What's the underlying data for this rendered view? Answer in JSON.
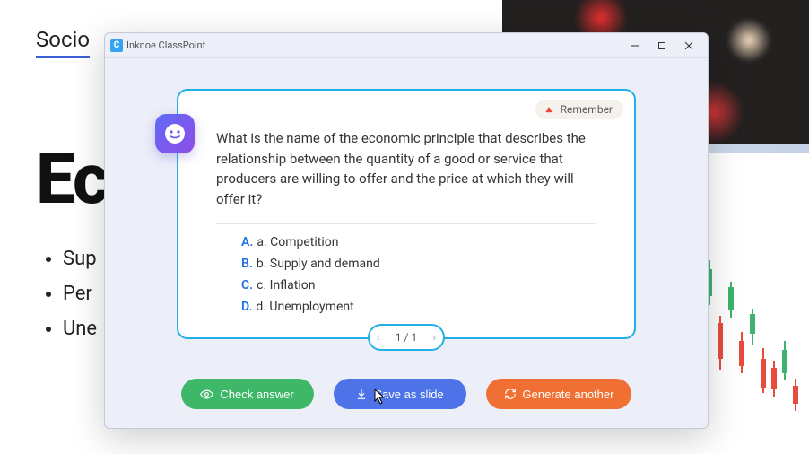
{
  "background": {
    "header_partial": "Socio",
    "big_partial": "Ec",
    "bullets": [
      "Sup",
      "Per",
      "Une"
    ]
  },
  "window": {
    "title": "Inknoe ClassPoint"
  },
  "card": {
    "tag": {
      "icon": "🔺",
      "label": "Remember"
    },
    "question": "What is the name of the economic principle that describes the relationship between the quantity of a good or service that producers are willing to offer and the price at which they will offer it?",
    "options": [
      {
        "letter": "A.",
        "text": "a. Competition"
      },
      {
        "letter": "B.",
        "text": "b. Supply and demand"
      },
      {
        "letter": "C.",
        "text": "c. Inflation"
      },
      {
        "letter": "D.",
        "text": "d. Unemployment"
      }
    ]
  },
  "pager": {
    "current": 1,
    "total": 1,
    "display": "1 / 1"
  },
  "actions": {
    "check": "Check answer",
    "save": "Save as slide",
    "generate": "Generate another"
  },
  "colors": {
    "card_border": "#22b0e6",
    "btn_green": "#3fb768",
    "btn_blue": "#4e73e8",
    "btn_orange": "#f07033",
    "option_letter": "#1f6fe5"
  }
}
